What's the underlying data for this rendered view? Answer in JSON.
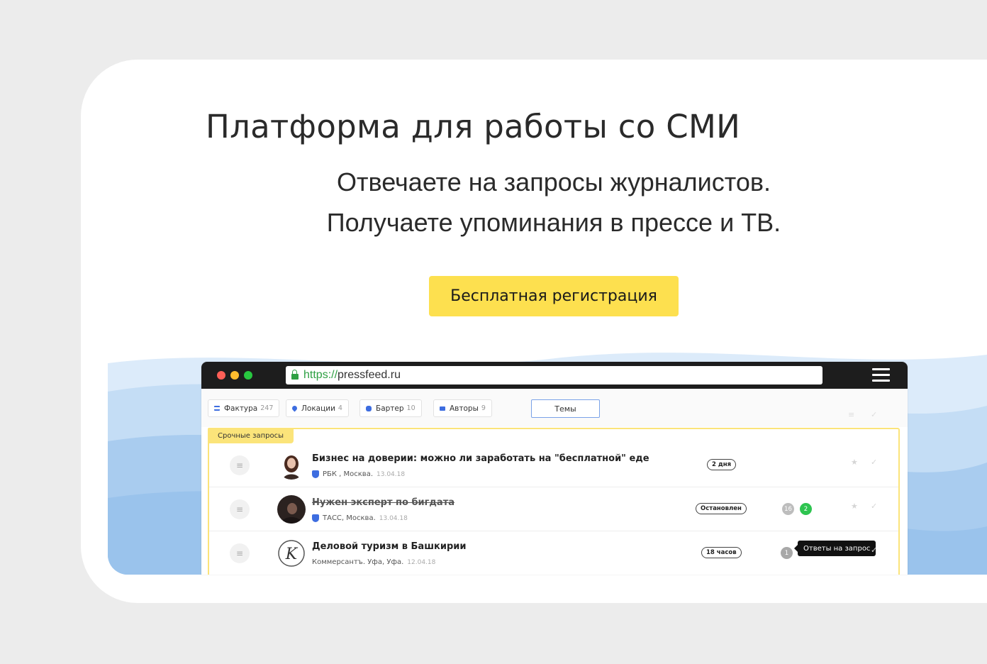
{
  "hero": {
    "title": "Платформа для работы со СМИ",
    "subtitle_line1": "Отвечаете на запросы журналистов.",
    "subtitle_line2": "Получаете упоминания в прессе и ТВ.",
    "cta_label": "Бесплатная регистрация"
  },
  "browser": {
    "url_scheme": "https://",
    "url_host": "pressfeed.ru"
  },
  "filters": [
    {
      "label": "Фактура",
      "count": "247",
      "icon": "list-icon"
    },
    {
      "label": "Локации",
      "count": "4",
      "icon": "location-pin-icon"
    },
    {
      "label": "Бартер",
      "count": "10",
      "icon": "puzzle-icon"
    },
    {
      "label": "Авторы",
      "count": "9",
      "icon": "authors-icon"
    }
  ],
  "themes_label": "Темы",
  "urgent_label": "Срочные запросы",
  "requests": [
    {
      "title": "Бизнес на доверии: можно ли заработать на \"бесплатной\" еде",
      "source": "РБК , Москва.",
      "date": "13.04.18",
      "status": "2 дня",
      "struck": false
    },
    {
      "title": "Нужен эксперт по бигдата",
      "source": "ТАСС, Москва.",
      "date": "13.04.18",
      "status": "Остановлен",
      "answers": "16",
      "new_answers": "2",
      "struck": true
    },
    {
      "title": "Деловой туризм в Башкирии",
      "source": "Коммерсантъ. Уфа, Уфа.",
      "date": "12.04.18",
      "status": "18 часов",
      "answers": "1",
      "tooltip": "Ответы на запрос",
      "struck": false
    }
  ],
  "colors": {
    "accent_yellow": "#fde04f",
    "brand_blue": "#3d6de0",
    "success_green": "#2ea043",
    "wave_blue": "#a9ccef"
  }
}
